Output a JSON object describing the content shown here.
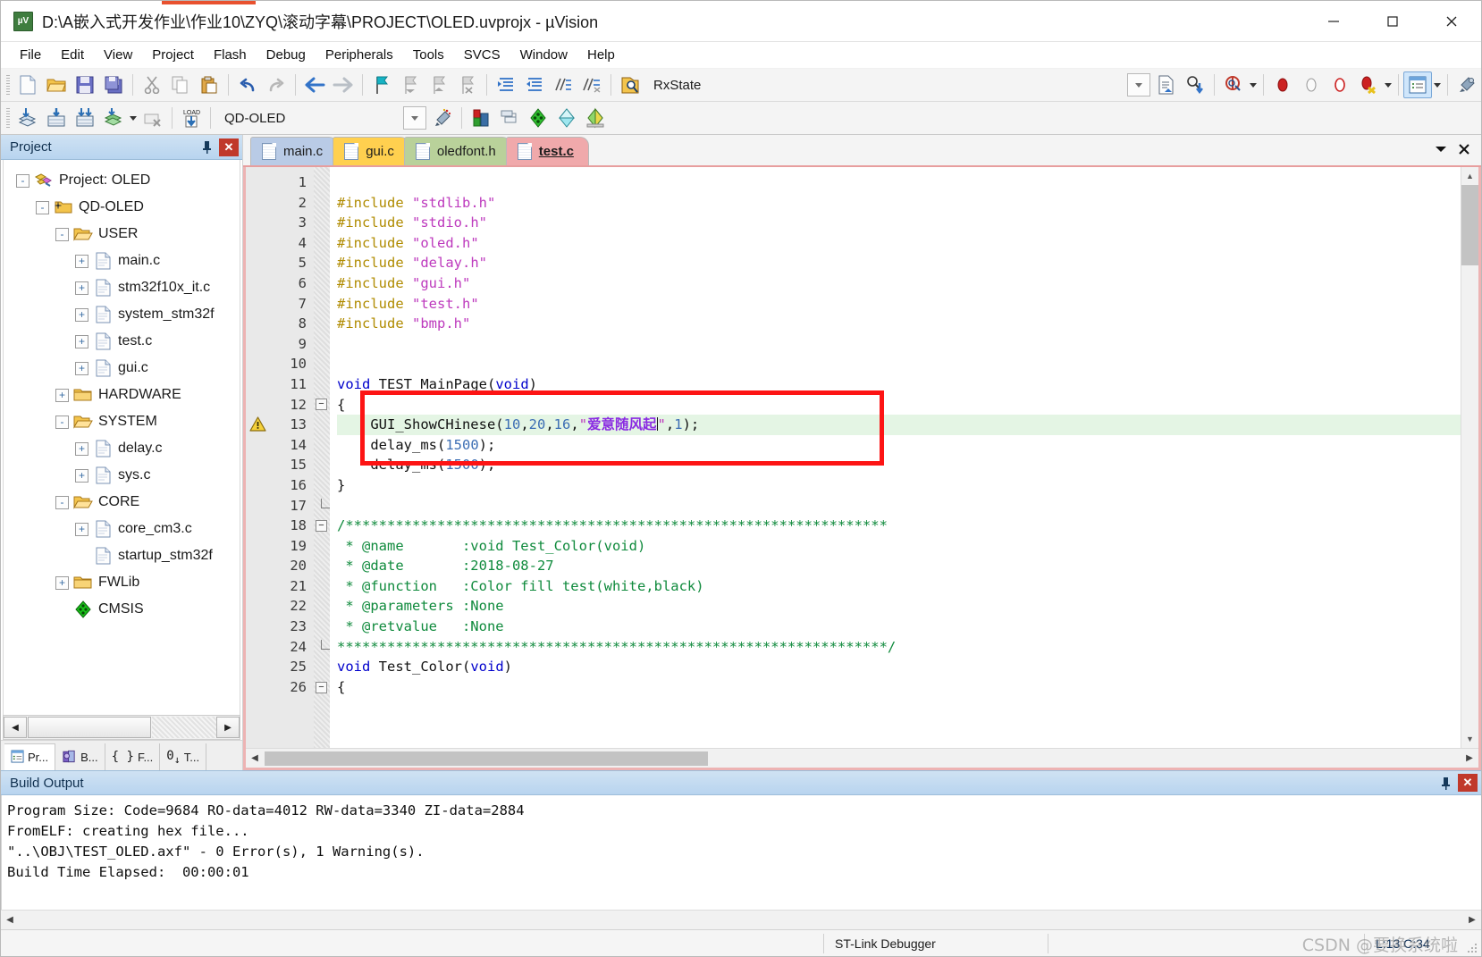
{
  "window": {
    "title": "D:\\A嵌入式开发作业\\作业10\\ZYQ\\滚动字幕\\PROJECT\\OLED.uvprojx - µVision",
    "minimize_label": "Minimize",
    "maximize_label": "Maximize",
    "close_label": "Close"
  },
  "menubar": {
    "items": [
      {
        "label": "File"
      },
      {
        "label": "Edit"
      },
      {
        "label": "View"
      },
      {
        "label": "Project"
      },
      {
        "label": "Flash"
      },
      {
        "label": "Debug"
      },
      {
        "label": "Peripherals"
      },
      {
        "label": "Tools"
      },
      {
        "label": "SVCS"
      },
      {
        "label": "Window"
      },
      {
        "label": "Help"
      }
    ]
  },
  "toolbar_main": {
    "icons": [
      "new-file-icon",
      "open-file-icon",
      "save-icon",
      "save-all-icon",
      "cut-icon",
      "copy-icon",
      "paste-icon",
      "undo-icon",
      "redo-icon",
      "navigate-back-icon",
      "navigate-forward-icon",
      "bookmark-toggle-icon",
      "bookmark-prev-icon",
      "bookmark-next-icon",
      "bookmark-clear-icon",
      "indent-icon",
      "outdent-icon",
      "comment-icon",
      "uncomment-icon",
      "find-in-files-icon"
    ],
    "search_value": "RxState",
    "search_placeholder": "",
    "right_icons": [
      "combo-dropdown-icon",
      "insert-file-icon",
      "find-icon",
      "debug-start-icon",
      "breakpoint-insert-icon",
      "breakpoint-disable-icon",
      "breakpoint-disable-all-icon",
      "breakpoint-kill-all-icon",
      "project-window-icon",
      "configuration-wizard-icon"
    ]
  },
  "toolbar_build": {
    "icons": [
      "translate-icon",
      "build-icon",
      "rebuild-icon",
      "batch-build-icon",
      "stop-build-icon",
      "download-icon"
    ],
    "target_value": "QD-OLED",
    "right_icons": [
      "target-dropdown-icon",
      "target-options-icon",
      "manage-project-items-icon",
      "manage-multi-project-icon",
      "pack-installer-icon",
      "manage-runtime-icon",
      "pack-select-icon"
    ]
  },
  "project_pane": {
    "title": "Project",
    "pin_label": "Auto Hide",
    "close_label": "Close",
    "tree": [
      {
        "label": "Project: OLED",
        "depth": 0,
        "expander": "-",
        "icon": "project-icon"
      },
      {
        "label": "QD-OLED",
        "depth": 1,
        "expander": "-",
        "icon": "target-folder-icon"
      },
      {
        "label": "USER",
        "depth": 2,
        "expander": "-",
        "icon": "open-folder-icon"
      },
      {
        "label": "main.c",
        "depth": 3,
        "expander": "+",
        "icon": "c-file-icon"
      },
      {
        "label": "stm32f10x_it.c",
        "depth": 3,
        "expander": "+",
        "icon": "c-file-icon"
      },
      {
        "label": "system_stm32f",
        "depth": 3,
        "expander": "+",
        "icon": "c-file-icon"
      },
      {
        "label": "test.c",
        "depth": 3,
        "expander": "+",
        "icon": "c-file-icon"
      },
      {
        "label": "gui.c",
        "depth": 3,
        "expander": "+",
        "icon": "c-file-icon"
      },
      {
        "label": "HARDWARE",
        "depth": 2,
        "expander": "+",
        "icon": "closed-folder-icon"
      },
      {
        "label": "SYSTEM",
        "depth": 2,
        "expander": "-",
        "icon": "open-folder-icon"
      },
      {
        "label": "delay.c",
        "depth": 3,
        "expander": "+",
        "icon": "c-file-icon"
      },
      {
        "label": "sys.c",
        "depth": 3,
        "expander": "+",
        "icon": "c-file-icon"
      },
      {
        "label": "CORE",
        "depth": 2,
        "expander": "-",
        "icon": "open-folder-icon"
      },
      {
        "label": "core_cm3.c",
        "depth": 3,
        "expander": "+",
        "icon": "c-file-icon"
      },
      {
        "label": "startup_stm32f",
        "depth": 3,
        "expander": "",
        "icon": "asm-file-icon"
      },
      {
        "label": "FWLib",
        "depth": 2,
        "expander": "+",
        "icon": "closed-folder-icon"
      },
      {
        "label": "CMSIS",
        "depth": 2,
        "expander": "",
        "icon": "cmsis-icon"
      }
    ],
    "bottom_tabs": [
      {
        "label": "Pr...",
        "icon": "project-window-icon",
        "selected": true
      },
      {
        "label": "B...",
        "icon": "books-icon",
        "selected": false
      },
      {
        "label": "F...",
        "icon": "functions-icon",
        "selected": false
      },
      {
        "label": "T...",
        "icon": "templates-icon",
        "selected": false
      }
    ],
    "scroll_left_label": "◀",
    "scroll_right_label": "▶"
  },
  "editor": {
    "tabs": [
      {
        "label": "main.c",
        "active": false,
        "color": "#b9cbe6"
      },
      {
        "label": "gui.c",
        "active": false,
        "color": "#ffd04f"
      },
      {
        "label": "oledfont.h",
        "active": false,
        "color": "#b9d19a"
      },
      {
        "label": "test.c",
        "active": true,
        "color": "#f0a9ab"
      }
    ],
    "tabstrip_menu_label": "▼",
    "tabstrip_close_label": "✕",
    "first_line": 1,
    "line_count": 26,
    "warning_line": 13,
    "highlight_line": 13,
    "lines": [
      {
        "n": 1,
        "fold": "",
        "tokens": []
      },
      {
        "n": 2,
        "fold": "",
        "tokens": [
          {
            "t": "#include ",
            "c": "k-pre"
          },
          {
            "t": "\"stdlib.h\"",
            "c": "k-str"
          }
        ]
      },
      {
        "n": 3,
        "fold": "",
        "tokens": [
          {
            "t": "#include ",
            "c": "k-pre"
          },
          {
            "t": "\"stdio.h\"",
            "c": "k-str"
          }
        ]
      },
      {
        "n": 4,
        "fold": "",
        "tokens": [
          {
            "t": "#include ",
            "c": "k-pre"
          },
          {
            "t": "\"oled.h\"",
            "c": "k-str"
          }
        ]
      },
      {
        "n": 5,
        "fold": "",
        "tokens": [
          {
            "t": "#include ",
            "c": "k-pre"
          },
          {
            "t": "\"delay.h\"",
            "c": "k-str"
          }
        ]
      },
      {
        "n": 6,
        "fold": "",
        "tokens": [
          {
            "t": "#include ",
            "c": "k-pre"
          },
          {
            "t": "\"gui.h\"",
            "c": "k-str"
          }
        ]
      },
      {
        "n": 7,
        "fold": "",
        "tokens": [
          {
            "t": "#include ",
            "c": "k-pre"
          },
          {
            "t": "\"test.h\"",
            "c": "k-str"
          }
        ]
      },
      {
        "n": 8,
        "fold": "",
        "tokens": [
          {
            "t": "#include ",
            "c": "k-pre"
          },
          {
            "t": "\"bmp.h\"",
            "c": "k-str"
          }
        ]
      },
      {
        "n": 9,
        "fold": "",
        "tokens": []
      },
      {
        "n": 10,
        "fold": "",
        "tokens": []
      },
      {
        "n": 11,
        "fold": "",
        "tokens": [
          {
            "t": "void ",
            "c": "k-kw"
          },
          {
            "t": "TEST_MainPage(",
            "c": "k-plain"
          },
          {
            "t": "void",
            "c": "k-kw"
          },
          {
            "t": ")",
            "c": "k-plain"
          }
        ]
      },
      {
        "n": 12,
        "fold": "-",
        "tokens": [
          {
            "t": "{",
            "c": "k-plain"
          }
        ]
      },
      {
        "n": 13,
        "fold": "",
        "hl": true,
        "tokens": [
          {
            "t": "    GUI_ShowCHinese(",
            "c": "k-plain"
          },
          {
            "t": "10",
            "c": "k-num"
          },
          {
            "t": ",",
            "c": "k-plain"
          },
          {
            "t": "20",
            "c": "k-num"
          },
          {
            "t": ",",
            "c": "k-plain"
          },
          {
            "t": "16",
            "c": "k-num"
          },
          {
            "t": ",",
            "c": "k-plain"
          },
          {
            "t": "\"",
            "c": "k-str"
          },
          {
            "t": "爱意随风起",
            "c": "k-cn"
          },
          {
            "t": "\"",
            "c": "k-str"
          },
          {
            "t": ",",
            "c": "k-plain"
          },
          {
            "t": "1",
            "c": "k-num"
          },
          {
            "t": ");",
            "c": "k-plain"
          }
        ]
      },
      {
        "n": 14,
        "fold": "",
        "tokens": [
          {
            "t": "    delay_ms(",
            "c": "k-plain"
          },
          {
            "t": "1500",
            "c": "k-num"
          },
          {
            "t": ");",
            "c": "k-plain"
          }
        ]
      },
      {
        "n": 15,
        "fold": "",
        "tokens": [
          {
            "t": "    delay_ms(",
            "c": "k-plain"
          },
          {
            "t": "1500",
            "c": "k-num"
          },
          {
            "t": ");",
            "c": "k-plain"
          }
        ]
      },
      {
        "n": 16,
        "fold": "",
        "tokens": [
          {
            "t": "}",
            "c": "k-plain"
          }
        ]
      },
      {
        "n": 17,
        "fold": "L",
        "tokens": []
      },
      {
        "n": 18,
        "fold": "-",
        "tokens": [
          {
            "t": "/*****************************************************************",
            "c": "k-cmt"
          }
        ]
      },
      {
        "n": 19,
        "fold": "",
        "tokens": [
          {
            "t": " * @name       :void Test_Color(void)",
            "c": "k-cmt"
          }
        ]
      },
      {
        "n": 20,
        "fold": "",
        "tokens": [
          {
            "t": " * @date       :2018-08-27",
            "c": "k-cmt"
          }
        ]
      },
      {
        "n": 21,
        "fold": "",
        "tokens": [
          {
            "t": " * @function   :Color fill test(white,black)",
            "c": "k-cmt"
          }
        ]
      },
      {
        "n": 22,
        "fold": "",
        "tokens": [
          {
            "t": " * @parameters :None",
            "c": "k-cmt"
          }
        ]
      },
      {
        "n": 23,
        "fold": "",
        "tokens": [
          {
            "t": " * @retvalue   :None",
            "c": "k-cmt"
          }
        ]
      },
      {
        "n": 24,
        "fold": "L",
        "tokens": [
          {
            "t": "******************************************************************/",
            "c": "k-cmt"
          }
        ]
      },
      {
        "n": 25,
        "fold": "",
        "tokens": [
          {
            "t": "void ",
            "c": "k-kw"
          },
          {
            "t": "Test_Color(",
            "c": "k-plain"
          },
          {
            "t": "void",
            "c": "k-kw"
          },
          {
            "t": ")",
            "c": "k-plain"
          }
        ]
      },
      {
        "n": 26,
        "fold": "-",
        "tokens": [
          {
            "t": "{",
            "c": "k-plain"
          }
        ]
      }
    ],
    "annotation_note": "red-rectangle-highlight"
  },
  "build_output": {
    "title": "Build Output",
    "pin_label": "Auto Hide",
    "close_label": "Close",
    "lines": [
      "Program Size: Code=9684 RO-data=4012 RW-data=3340 ZI-data=2884",
      "FromELF: creating hex file...",
      "\"..\\OBJ\\TEST_OLED.axf\" - 0 Error(s), 1 Warning(s).",
      "Build Time Elapsed:  00:00:01"
    ]
  },
  "statusbar": {
    "debugger": "ST-Link Debugger",
    "cursor": "L:13 C:34",
    "watermark": "CSDN @要换系统啦"
  },
  "colors": {
    "accent_red": "#fd1414",
    "tab_active": "#f0a9ab",
    "pane_header": "#b8d4ef",
    "highlight_line": "#e4f5e4"
  }
}
